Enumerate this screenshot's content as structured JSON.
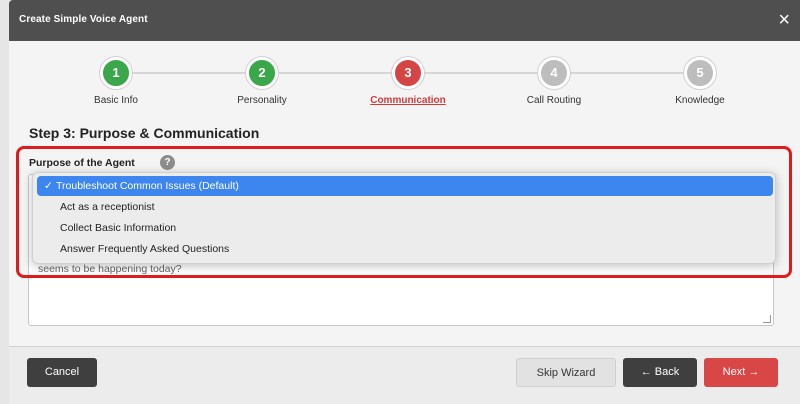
{
  "modal": {
    "title": "Create Simple Voice Agent",
    "close_glyph": "×"
  },
  "stepper": {
    "steps": [
      {
        "number": "1",
        "label": "Basic Info",
        "state": "complete",
        "color": "#3aa84a"
      },
      {
        "number": "2",
        "label": "Personality",
        "state": "complete",
        "color": "#3aa84a"
      },
      {
        "number": "3",
        "label": "Communication",
        "state": "active",
        "color": "#d64545"
      },
      {
        "number": "4",
        "label": "Call Routing",
        "state": "pending",
        "color": "#bdbdbd"
      },
      {
        "number": "5",
        "label": "Knowledge",
        "state": "pending",
        "color": "#bdbdbd"
      }
    ]
  },
  "step_heading": "Step 3: Purpose & Communication",
  "purpose": {
    "label": "Purpose of the Agent",
    "help_glyph": "?",
    "options": [
      {
        "label": "Troubleshoot Common Issues (Default)",
        "selected": true
      },
      {
        "label": "Act as a receptionist",
        "selected": false
      },
      {
        "label": "Collect Basic Information",
        "selected": false
      },
      {
        "label": "Answer Frequently Asked Questions",
        "selected": false
      }
    ],
    "check_glyph": "✓",
    "textarea_visible_text": "seems to be happening today?"
  },
  "footer": {
    "cancel_label": "Cancel",
    "skip_label": "Skip Wizard",
    "back_label": "Back",
    "next_label": "Next"
  },
  "icons": {
    "back_arrow": "🡐",
    "next_arrow": "🡒"
  },
  "colors": {
    "accent_red": "#d64545",
    "highlight_red": "#e01b1b",
    "selected_blue": "#3d86f0",
    "complete_green": "#3aa84a"
  }
}
